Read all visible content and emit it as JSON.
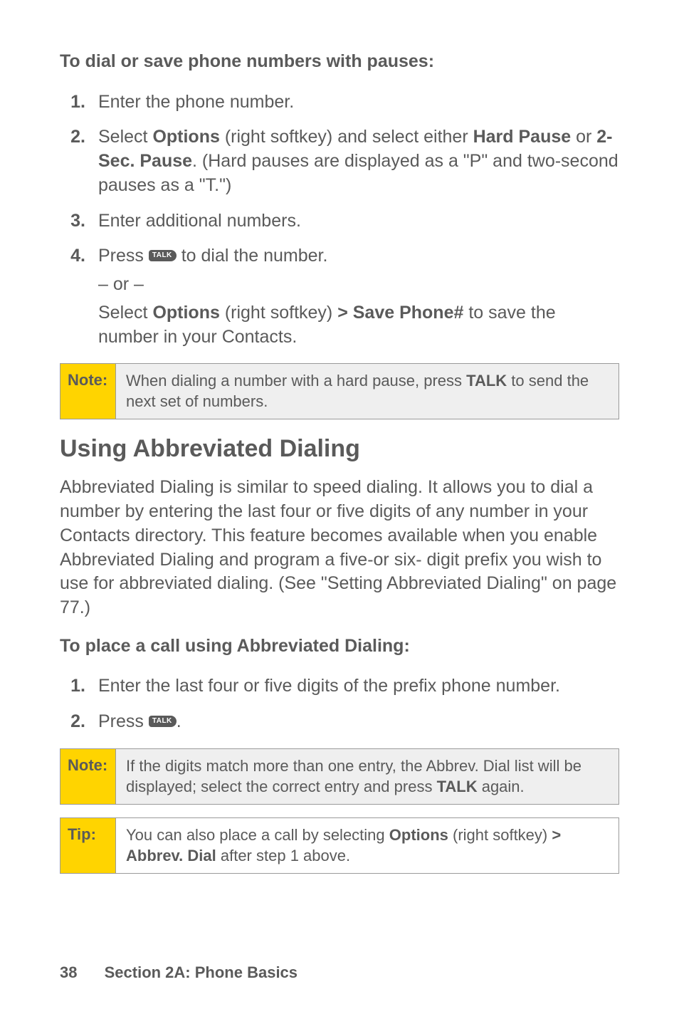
{
  "intro1": "To dial or save phone numbers with pauses:",
  "list1": {
    "n1": "1.",
    "i1": "Enter the phone number.",
    "n2": "2.",
    "i2a": "Select ",
    "i2b": "Options",
    "i2c": " (right softkey) and select either ",
    "i2d": "Hard Pause",
    "i2e": " or ",
    "i2f": "2-Sec. Pause",
    "i2g": ". (Hard pauses are displayed as a \"P\" and two-second pauses as a \"T.\")",
    "n3": "3.",
    "i3": "Enter additional numbers.",
    "n4": "4.",
    "i4a": "Press ",
    "talk1": "TALK",
    "i4b": " to dial the number.",
    "or": "– or –",
    "i4c": "Select ",
    "i4d": "Options",
    "i4e": " (right softkey) ",
    "i4f": "> Save Phone#",
    "i4g": " to save the number in your Contacts."
  },
  "note1": {
    "label": "Note:",
    "t1": "When dialing a number with a hard pause, press ",
    "t2": "TALK",
    "t3": " to send the next set of numbers."
  },
  "h2": "Using Abbreviated Dialing",
  "para": "Abbreviated Dialing is similar to speed dialing. It allows you to dial a number by entering the last four or five digits of any number in your Contacts directory. This feature becomes available when you enable Abbreviated Dialing and program a five-or six- digit prefix you wish to use for abbreviated dialing. (See \"Setting Abbreviated Dialing\" on page 77.)",
  "intro2": "To place a call using Abbreviated Dialing:",
  "list2": {
    "n1": "1.",
    "i1": "Enter the last four or five digits of the prefix phone number.",
    "n2": "2.",
    "i2a": "Press ",
    "talk2": "TALK",
    "i2b": "."
  },
  "note2": {
    "label": "Note:",
    "t1": "If the digits match more than one entry, the Abbrev. Dial list will be displayed; select the correct entry and press ",
    "t2": "TALK",
    "t3": " again."
  },
  "tip": {
    "label": "Tip:",
    "t1": "You can also place a call by selecting ",
    "t2": "Options",
    "t3": " (right softkey) ",
    "t4": "> Abbrev. Dial",
    "t5": " after step 1 above."
  },
  "footer": {
    "page": "38",
    "section": "Section 2A: Phone Basics"
  }
}
